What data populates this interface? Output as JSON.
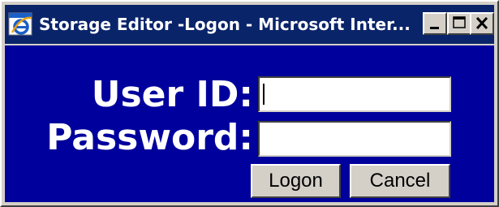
{
  "window": {
    "title": "Storage Editor -Logon - Microsoft Inter...",
    "icon": "ie-icon",
    "controls": {
      "minimize_icon": "minimize-icon",
      "maximize_icon": "maximize-icon",
      "close_icon": "close-icon"
    }
  },
  "form": {
    "user_id_label": "User ID:",
    "user_id_value": "",
    "password_label": "Password:",
    "password_value": "",
    "logon_label": "Logon",
    "cancel_label": "Cancel"
  },
  "colors": {
    "titlebar": "#0a246a",
    "content_background": "#00009c",
    "label_text": "#ffffff",
    "button_face": "#d4d0c8"
  }
}
